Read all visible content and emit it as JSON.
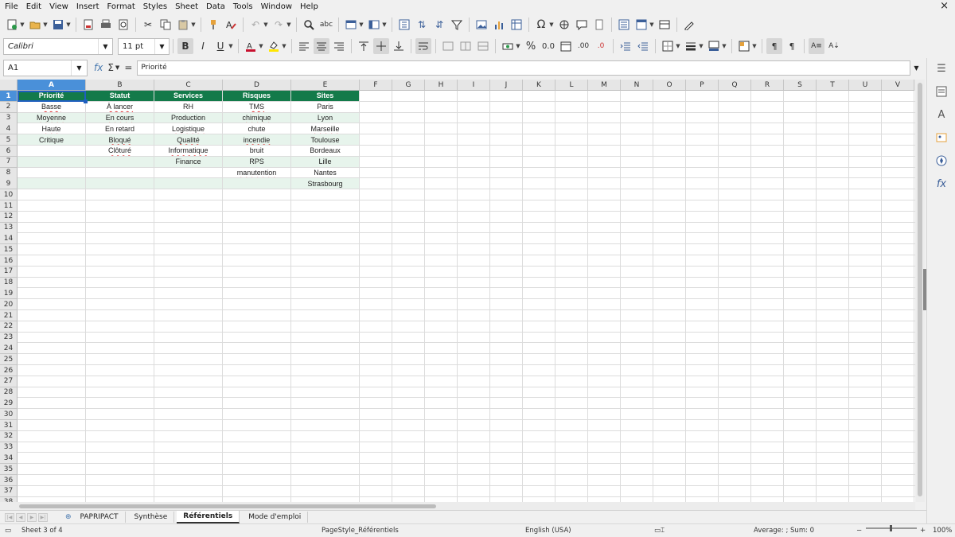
{
  "menu": [
    "File",
    "Edit",
    "View",
    "Insert",
    "Format",
    "Styles",
    "Sheet",
    "Data",
    "Tools",
    "Window",
    "Help"
  ],
  "close_label": "×",
  "font": {
    "name": "Calibri",
    "size": "11 pt"
  },
  "name_box": "A1",
  "formula_content": "Priorité",
  "columns": [
    "A",
    "B",
    "C",
    "D",
    "E",
    "F",
    "G",
    "H",
    "I",
    "J",
    "K",
    "L",
    "M",
    "N",
    "O",
    "P",
    "Q",
    "R",
    "S",
    "T",
    "U",
    "V"
  ],
  "rows": [
    "1",
    "2",
    "3",
    "4",
    "5",
    "6",
    "7",
    "8",
    "9",
    "10",
    "11",
    "12",
    "13",
    "14",
    "15",
    "16",
    "17",
    "18",
    "19",
    "20",
    "21",
    "22",
    "23",
    "24",
    "25",
    "26",
    "27",
    "28",
    "29",
    "30",
    "31",
    "32",
    "33",
    "34",
    "35",
    "36",
    "37",
    "38"
  ],
  "table": {
    "headers": [
      "Priorité",
      "Statut",
      "Services",
      "Risques",
      "Sites"
    ],
    "data": [
      [
        "Basse",
        "À lancer",
        "RH",
        "TMS",
        "Paris"
      ],
      [
        "Moyenne",
        "En cours",
        "Production",
        "chimique",
        "Lyon"
      ],
      [
        "Haute",
        "En retard",
        "Logistique",
        "chute",
        "Marseille"
      ],
      [
        "Critique",
        "Bloqué",
        "Qualité",
        "incendie",
        "Toulouse"
      ],
      [
        "",
        "Clôturé",
        "Informatique",
        "bruit",
        "Bordeaux"
      ],
      [
        "",
        "",
        "Finance",
        "RPS",
        "Lille"
      ],
      [
        "",
        "",
        "",
        "manutention",
        "Nantes"
      ],
      [
        "",
        "",
        "",
        "",
        "Strasbourg"
      ]
    ],
    "spellcheck_cells": [
      [
        0,
        0
      ],
      [
        0,
        1
      ],
      [
        0,
        3
      ],
      [
        1,
        0
      ],
      [
        1,
        1
      ],
      [
        1,
        3
      ],
      [
        2,
        0
      ],
      [
        2,
        2
      ],
      [
        2,
        4
      ],
      [
        3,
        1
      ],
      [
        3,
        2
      ],
      [
        3,
        3
      ],
      [
        4,
        1
      ],
      [
        4,
        2
      ],
      [
        6,
        3
      ]
    ]
  },
  "colors": {
    "header_bg": "#137a4a",
    "band_bg": "#e7f4ec",
    "selection": "#1f5fbf"
  },
  "sheet_tabs": [
    "PAPRIPACT",
    "Synthèse",
    "Référentiels",
    "Mode d'emploi"
  ],
  "active_tab_index": 2,
  "status": {
    "sheet": "Sheet 3 of 4",
    "page_style": "PageStyle_Référentiels",
    "language": "English (USA)",
    "summary": "Average: ; Sum: 0",
    "zoom": "100%"
  }
}
